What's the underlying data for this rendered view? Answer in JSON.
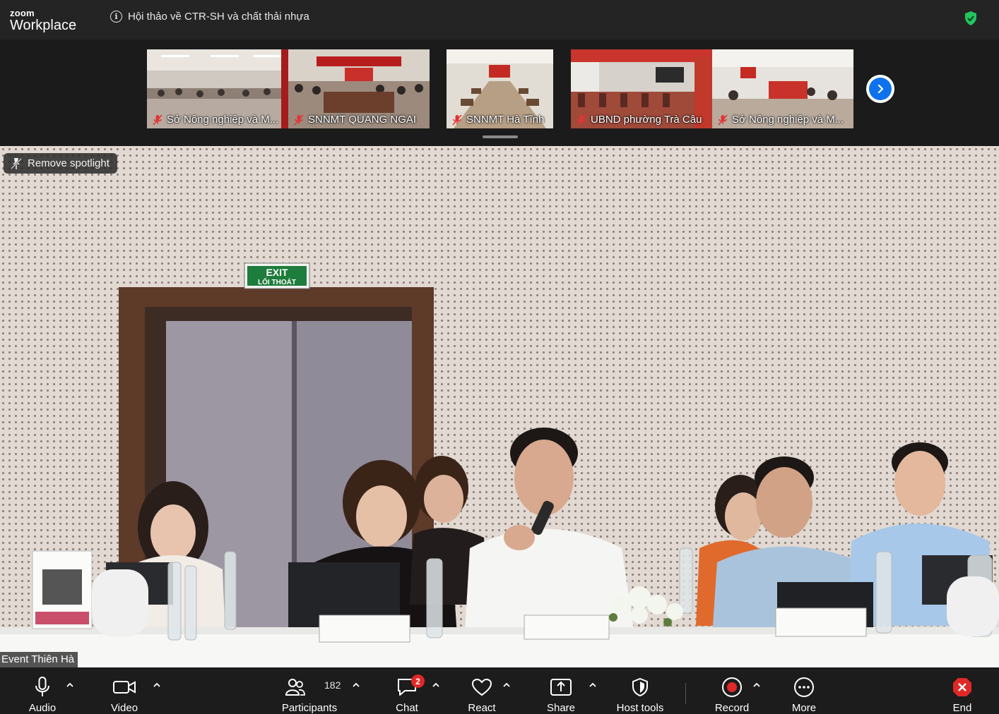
{
  "app": {
    "brand_small": "zoom",
    "brand_large": "Workplace"
  },
  "meeting": {
    "title": "Hội thảo về CTR-SH và chất thải nhựa"
  },
  "thumbnails": [
    {
      "name": "Sở Nông nghiệp và M..."
    },
    {
      "name": "SNNMT QUANG NGAI"
    },
    {
      "name": "SNNMT Hà Tĩnh"
    },
    {
      "name": "UBND phường Trà Câu"
    },
    {
      "name": "Sở Nông nghiệp và M..."
    }
  ],
  "main_video": {
    "spotlight_label": "Remove spotlight",
    "speaker_name": "Event Thiên Hà",
    "scene_text": {
      "exit_sign_top": "EXIT",
      "exit_sign_bottom": "LỐI THOÁT"
    }
  },
  "toolbar": {
    "audio": "Audio",
    "video": "Video",
    "participants": "Participants",
    "participants_count": "182",
    "chat": "Chat",
    "chat_badge": "2",
    "react": "React",
    "share": "Share",
    "host_tools": "Host tools",
    "record": "Record",
    "more": "More",
    "end": "End"
  },
  "colors": {
    "accent": "#0e72ed",
    "secure": "#22c55e",
    "danger": "#e02828",
    "toolbar_bg": "#1c1c1c"
  }
}
